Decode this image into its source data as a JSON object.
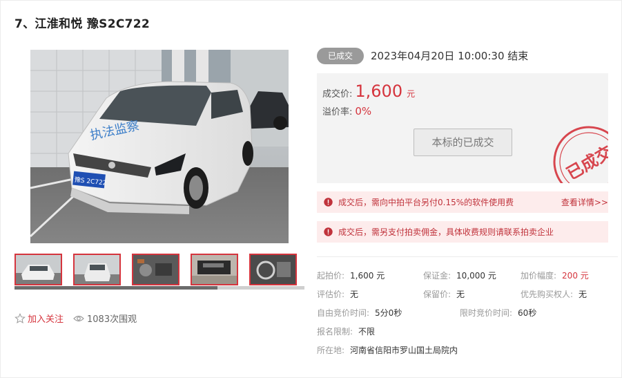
{
  "title": "7、江淮和悦 豫S2C722",
  "status": {
    "badge": "已成交",
    "end_time": "2023年04月20日  10:00:30 结束"
  },
  "price": {
    "deal_label": "成交价:",
    "deal_value": "1,600",
    "deal_unit": "元",
    "premium_label": "溢价率:",
    "premium_value": "0%",
    "sold_button": "本标的已成交",
    "stamp_text": "已成交"
  },
  "notices": [
    {
      "text": "成交后，需向中拍平台另付0.15%的软件使用费",
      "link": "查看详情>>"
    },
    {
      "text": "成交后，需另支付拍卖佣金，具体收费规则请联系拍卖企业"
    }
  ],
  "details": {
    "start_price": {
      "label": "起拍价:",
      "value": "1,600 元"
    },
    "deposit": {
      "label": "保证金:",
      "value": "10,000 元"
    },
    "increment": {
      "label": "加价幅度:",
      "value": "200 元"
    },
    "appraisal": {
      "label": "评估价:",
      "value": "无"
    },
    "reserve": {
      "label": "保留价:",
      "value": "无"
    },
    "priority": {
      "label": "优先购买权人:",
      "value": "无"
    },
    "free_bid_time": {
      "label": "自由竞价时间:",
      "value": "5分0秒"
    },
    "limited_bid_time": {
      "label": "限时竞价时间:",
      "value": "60秒"
    },
    "signup_limit": {
      "label": "报名限制:",
      "value": "不限"
    },
    "location": {
      "label": "所在地:",
      "value": "河南省信阳市罗山国土局院内"
    }
  },
  "photo": {
    "door_text": "执法监察",
    "plate": "豫S 2C722",
    "thumbnail_count": 5,
    "scroll_fraction": 0.7
  },
  "actions": {
    "follow": "加入关注",
    "views": "1083次围观"
  },
  "colors": {
    "accent": "#d5343d",
    "badge_gray": "#9a9a9a",
    "price_box_bg": "#f3f3f3",
    "notice_bg": "#fdecec"
  },
  "icons": [
    "star-icon",
    "eye-icon",
    "warning-icon",
    "sold-stamp"
  ]
}
